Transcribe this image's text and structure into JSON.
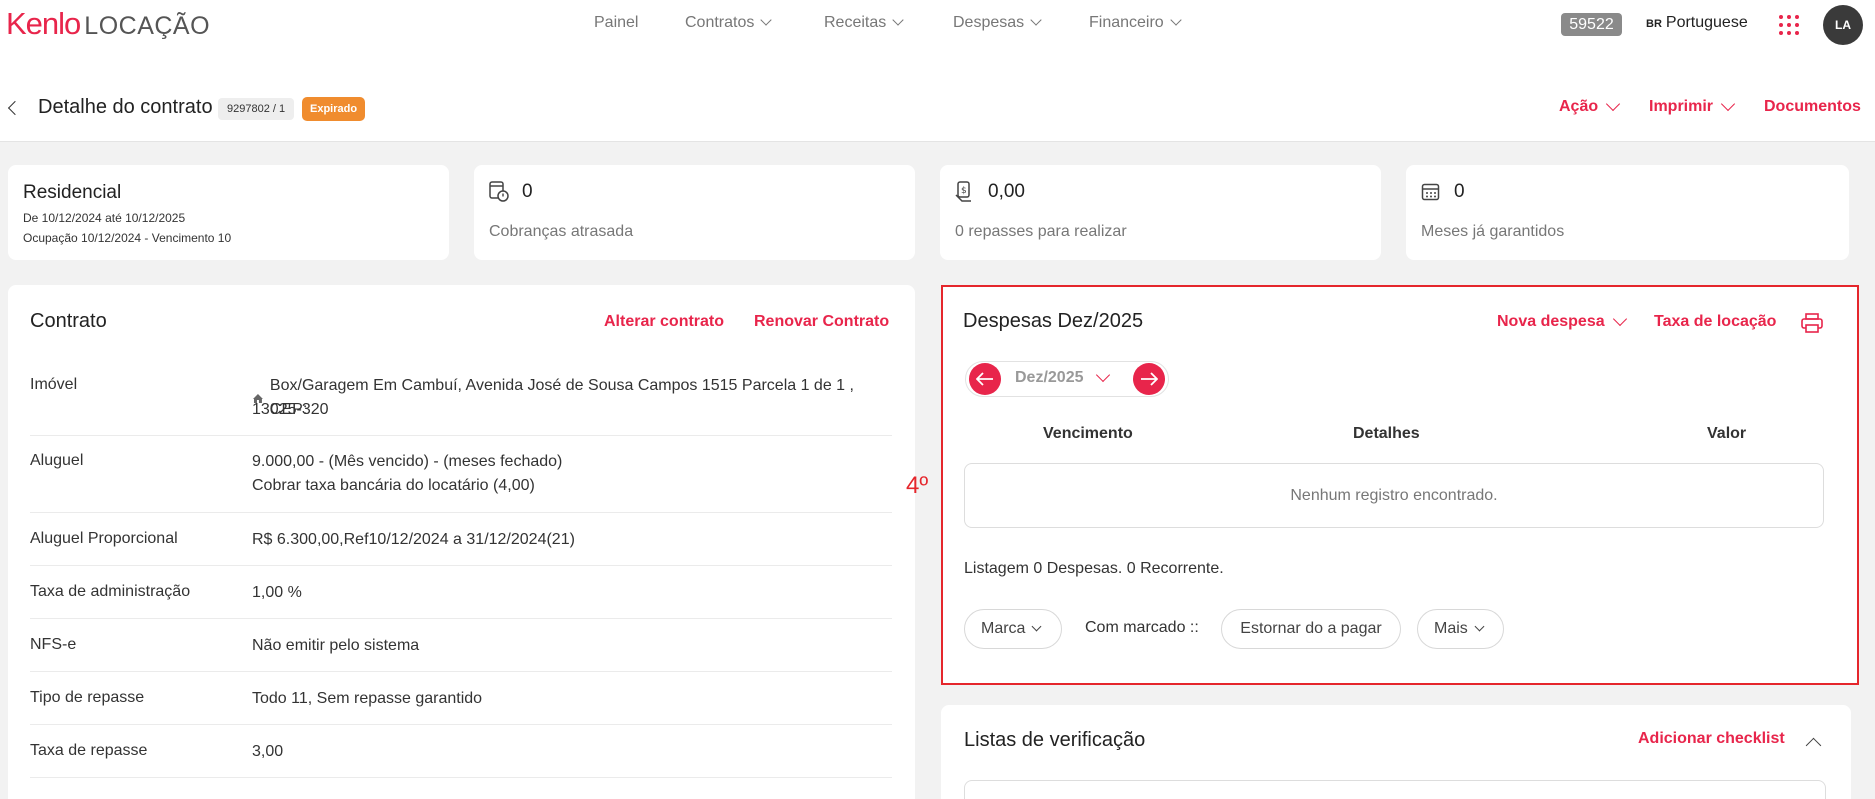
{
  "brand": {
    "logo": "Kenlo",
    "product": "LOCAÇÃO"
  },
  "nav": {
    "items": [
      {
        "label": "Painel"
      },
      {
        "label": "Contratos"
      },
      {
        "label": "Receitas"
      },
      {
        "label": "Despesas"
      },
      {
        "label": "Financeiro"
      }
    ]
  },
  "header": {
    "code_badge": "59522",
    "language_code": "BR",
    "language": "Portuguese",
    "avatar_initials": "LA"
  },
  "contract_header": {
    "title": "Detalhe do contrato",
    "contract_id": "9297802 / 1",
    "status": "Expirado",
    "actions": {
      "acao": "Ação",
      "imprimir": "Imprimir",
      "documentos": "Documentos"
    }
  },
  "stats": {
    "type": {
      "title": "Residencial",
      "period": "De 10/12/2024 até 10/12/2025",
      "occupation": "Ocupação 10/12/2024 - Vencimento 10"
    },
    "overdue": {
      "value": "0",
      "label": "Cobranças atrasada"
    },
    "transfers": {
      "value": "0,00",
      "label": "0 repasses para realizar"
    },
    "guaranteed": {
      "value": "0",
      "label": "Meses já garantidos"
    }
  },
  "contract": {
    "title": "Contrato",
    "alter_label": "Alterar contrato",
    "renew_label": "Renovar Contrato",
    "rows": [
      {
        "label": "Imóvel",
        "value": "Box/Garagem Em Cambuí, Avenida José de Sousa Campos 1515 Parcela 1 de 1 , CEP:",
        "value2": "13025-320"
      },
      {
        "label": "Aluguel",
        "value": "9.000,00 - (Mês vencido) - (meses fechado)",
        "value2": "Cobrar taxa bancária do locatário (4,00)"
      },
      {
        "label": "Aluguel Proporcional",
        "value": "R$ 6.300,00,Ref10/12/2024 a 31/12/2024(21)"
      },
      {
        "label": "Taxa de administração",
        "value": "1,00 %"
      },
      {
        "label": "NFS-e",
        "value": "Não emitir pelo sistema"
      },
      {
        "label": "Tipo de repasse",
        "value": "Todo 11, Sem repasse garantido"
      },
      {
        "label": "Taxa de repasse",
        "value": "3,00"
      }
    ]
  },
  "annotation": {
    "label": "4º",
    "color": "#e5262c"
  },
  "expenses": {
    "title": "Despesas Dez/2025",
    "new_expense_label": "Nova despesa",
    "rent_fee_label": "Taxa de locação",
    "month_selector": "Dez/2025",
    "columns": {
      "due": "Vencimento",
      "details": "Detalhes",
      "value": "Valor"
    },
    "empty_message": "Nenhum registro encontrado.",
    "summary": "Listagem 0 Despesas. 0 Recorrente.",
    "mark_label": "Marca",
    "with_marked_label": "Com marcado ::",
    "reverse_label": "Estornar do a pagar",
    "more_label": "Mais"
  },
  "checklists": {
    "title": "Listas de verificação",
    "add_label": "Adicionar checklist"
  },
  "colors": {
    "accent": "#e8254b",
    "expired": "#f08c2e",
    "highlight": "#e5262c"
  }
}
